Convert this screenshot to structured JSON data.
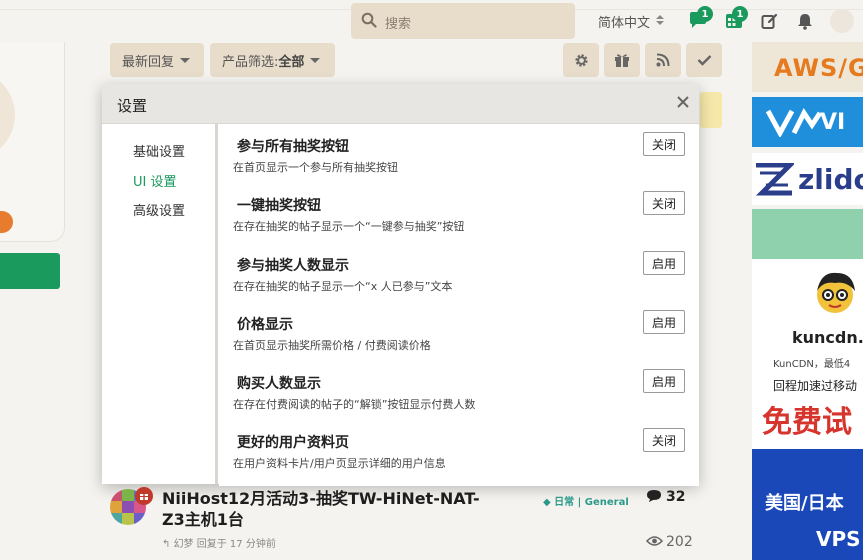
{
  "header": {
    "search_placeholder": "搜索",
    "language": "简体中文",
    "messages_badge": "1",
    "tasks_badge": "1"
  },
  "toolbar": {
    "sort_label": "最新回复",
    "filter_label": "产品筛选: ",
    "filter_value": "全部"
  },
  "modal": {
    "title": "设置",
    "nav": [
      {
        "label": "基础设置"
      },
      {
        "label": "UI 设置"
      },
      {
        "label": "高级设置"
      }
    ],
    "settings": [
      {
        "title": "参与所有抽奖按钮",
        "desc": "在首页显示一个参与所有抽奖按钮",
        "button": "关闭"
      },
      {
        "title": "一键抽奖按钮",
        "desc": "在存在抽奖的帖子显示一个“一键参与抽奖”按钮",
        "button": "关闭"
      },
      {
        "title": "参与抽奖人数显示",
        "desc": "在存在抽奖的帖子显示一个“x 人已参与”文本",
        "button": "启用"
      },
      {
        "title": "价格显示",
        "desc": "在首页显示抽奖所需价格 / 付费阅读价格",
        "button": "启用"
      },
      {
        "title": "购买人数显示",
        "desc": "在存在付费阅读的帖子的“解锁”按钮显示付费人数",
        "button": "启用"
      },
      {
        "title": "更好的用户资料页",
        "desc": "在用户资料卡片/用户页显示详细的用户信息",
        "button": "关闭"
      }
    ]
  },
  "topic": {
    "title": "NiiHost12月活动3-抽奖TW-HiNet-NAT-Z3主机1台",
    "tag": "日常 | General",
    "replies": "32",
    "views": "202",
    "author": "幻梦",
    "replied": "回复于 17 分钟前"
  },
  "ads": {
    "aws": "AWS/G",
    "vm": "VI",
    "zlido": "zlido",
    "kuncdn_brand": "kuncdn.c",
    "kuncdn_sub1": "KunCDN，最低4",
    "kuncdn_sub2": "回程加速过移动",
    "kuncdn_free": "免费试",
    "us_line1": "美国/日本",
    "us_line2": "VPS"
  },
  "colors": {
    "accent_green": "#1a9a5c",
    "toolbar_bg": "#e8dccb",
    "page_bg": "#f5f3ef"
  }
}
